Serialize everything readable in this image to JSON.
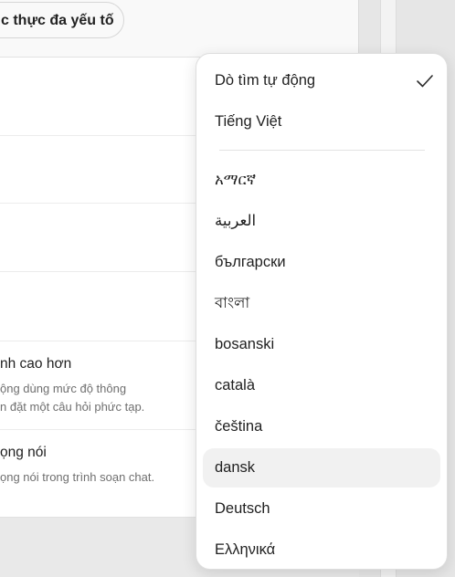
{
  "settings": {
    "mfa_button_label": "c thực đa yếu tố",
    "advanced": {
      "title": "nh cao hơn",
      "desc_line1": "ộng dùng mức độ thông",
      "desc_line2": "n đặt một câu hỏi phức tạp."
    },
    "voice": {
      "title": "ọng nói",
      "desc": "ọng nói trong trình soạn chat."
    }
  },
  "language_menu": {
    "selected": "Dò tìm tự động",
    "selected_mark": "check-icon",
    "hovered": "dansk",
    "hover_color": "#f1f1f1",
    "options": [
      "Dò tìm tự động",
      "Tiếng Việt",
      "አማርኛ",
      "العربية",
      "български",
      "বাংলা",
      "bosanski",
      "català",
      "čeština",
      "dansk",
      "Deutsch",
      "Ελληνικά"
    ]
  }
}
